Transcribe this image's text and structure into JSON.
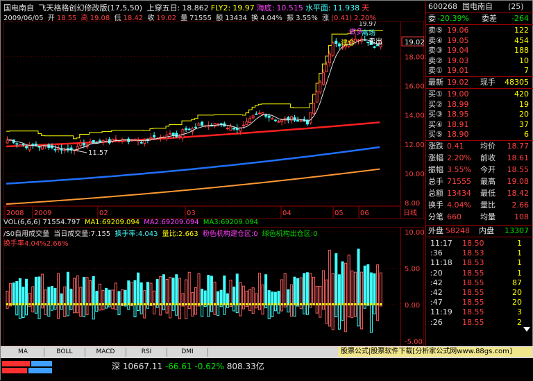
{
  "header": {
    "stock_name": "国电南自",
    "indicator": "飞天格格创幻修改版(17,5,50)",
    "sig1_label": "上穿五日:",
    "sig1_value": "18.862",
    "sig2_label": "FLY2:",
    "sig2_value": "19.97",
    "sig3_label": "海底:",
    "sig3_value": "10.515",
    "sig4_label": "水平面:",
    "sig4_value": "11.938",
    "sig5_label": "天"
  },
  "info": {
    "date": "2009/06/05",
    "open_label": "开",
    "open": "18.55",
    "high_label": "高",
    "high": "19.08",
    "low_label": "低",
    "low": "18.42",
    "close_label": "收",
    "close": "19.02",
    "vol_label": "量",
    "vol": "71555",
    "amt_label": "额",
    "amt": "13434",
    "turn_label": "换",
    "turn": "4.04%",
    "amp_label": "振",
    "amp": "3.55%",
    "chg_label": "涨",
    "chg": "(0.41)",
    "chg_pct": "2.20%"
  },
  "price_axis": [
    "19.02",
    "18.00",
    "16.00",
    "14.00",
    "12.00",
    "10.00",
    "8.00"
  ],
  "chart_labels": {
    "low_mark": "11.57",
    "high_mark": "19.97",
    "buy1": "建仓",
    "buy2": "做多",
    "sell": "离场",
    "sell2": "卖出"
  },
  "time_axis": [
    "2008",
    "2009",
    "02",
    "03",
    "04",
    "05",
    "06"
  ],
  "time_unit": "日线",
  "vol_header": {
    "l1": "VOL(6,6,6) 71554.797",
    "ma1": "MA1:69209.094",
    "ma2": "MA2:69209.094",
    "ma3": "MA3:69209.094",
    "l2a": "/S0自用成交量",
    "l2b": "当日成交量:7.155",
    "l2c": "换手率:4.043",
    "l2d": "量比:2.663",
    "l2e": "粉色机构建仓区:0",
    "l2f": "绿色机构出仓区:0",
    "l3": "换手率4.04%2.66%"
  },
  "vol_axis": [
    "10.00",
    "5.00",
    "0.00",
    "-5.00"
  ],
  "right": {
    "code": "600268",
    "name": "国电南自",
    "count": "(25)",
    "wb_label": "委",
    "wb": "-20.39%",
    "wc_label": "委差",
    "wc": "-264",
    "sells": [
      {
        "l": "卖⑤",
        "p": "19.06",
        "n": "122"
      },
      {
        "l": "卖④",
        "p": "19.05",
        "n": "454"
      },
      {
        "l": "卖③",
        "p": "19.04",
        "n": "188"
      },
      {
        "l": "卖②",
        "p": "19.03",
        "n": "10"
      },
      {
        "l": "卖①",
        "p": "19.01",
        "n": "7"
      }
    ],
    "last_label": "最新",
    "last": "19.02",
    "cur_label": "现手",
    "cur": "48305",
    "buys": [
      {
        "l": "买①",
        "p": "19.00",
        "n": "420"
      },
      {
        "l": "买②",
        "p": "18.99",
        "n": "19"
      },
      {
        "l": "买③",
        "p": "18.95",
        "n": "20"
      },
      {
        "l": "买④",
        "p": "18.91",
        "n": "37"
      },
      {
        "l": "买⑤",
        "p": "18.90",
        "n": "6"
      }
    ],
    "stats": [
      {
        "a": "涨跌",
        "av": "0.41",
        "b": "均价",
        "bv": "18.77"
      },
      {
        "a": "涨幅",
        "av": "2.20%",
        "b": "前收",
        "bv": "18.61"
      },
      {
        "a": "振幅",
        "av": "3.55%",
        "b": "今开",
        "bv": "18.55"
      },
      {
        "a": "总手",
        "av": "71555",
        "b": "最高",
        "bv": "19.08"
      },
      {
        "a": "总额",
        "av": "13434",
        "b": "最低",
        "bv": "18.42"
      },
      {
        "a": "换手",
        "av": "4.04%",
        "b": "量比",
        "bv": "2.66"
      },
      {
        "a": "分笔",
        "av": "660",
        "b": "均量",
        "bv": "108"
      }
    ],
    "outer_label": "外盘",
    "outer": "58248",
    "inner_label": "内盘",
    "inner": "13307",
    "ticks": [
      {
        "t": "11:17",
        "p": "18.50",
        "n": "1"
      },
      {
        "t": ":36",
        "p": "18.53",
        "n": "1"
      },
      {
        "t": "11:18",
        "p": "18.53",
        "n": "1"
      },
      {
        "t": ":20",
        "p": "18.55",
        "n": "1"
      },
      {
        "t": ":42",
        "p": "18.55",
        "n": "87"
      },
      {
        "t": ":42",
        "p": "18.55",
        "n": "20"
      },
      {
        "t": ":47",
        "p": "18.55",
        "n": "20"
      },
      {
        "t": "11:19",
        "p": "18.55",
        "n": "3"
      },
      {
        "t": ":26",
        "p": "18.55",
        "n": "2"
      }
    ]
  },
  "tabs": [
    "MA",
    "BOLL",
    "MACD",
    "RSI",
    "DMI"
  ],
  "ad": "股票公式|股票软件下载[分析家公式网www.88gs.com]",
  "status": {
    "index": "深",
    "val": "10667.11",
    "chg": "-66.61",
    "pct": "-0.62%",
    "amt": "808.33亿"
  }
}
